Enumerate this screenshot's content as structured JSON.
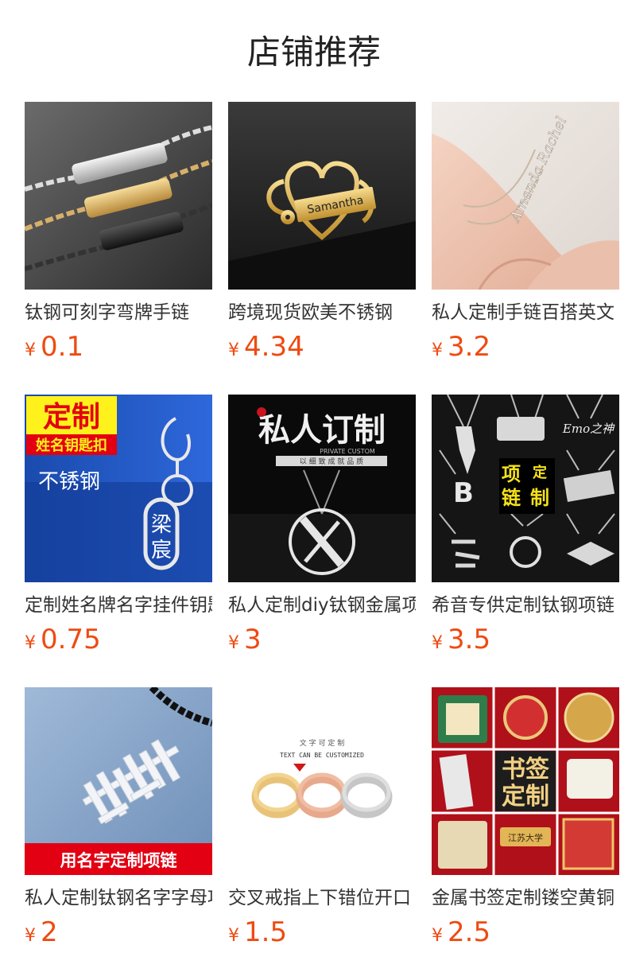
{
  "section_title": "店铺推荐",
  "colors": {
    "price": "#ee4b12",
    "title": "#222222",
    "name": "#333333"
  },
  "products": [
    {
      "name": "钛钢可刻字弯牌手链",
      "currency": "¥",
      "price": "0.1",
      "image": "engraved-bar-chain-bracelets-image"
    },
    {
      "name": "跨境现货欧美不锈钢",
      "currency": "¥",
      "price": "4.34",
      "image": "stethoscope-heart-name-badge-image",
      "image_text": "Samantha"
    },
    {
      "name": "私人定制手链百搭英文",
      "currency": "¥",
      "price": "3.2",
      "image": "name-bracelet-on-wrist-image",
      "image_text": "Amanda Rachel"
    },
    {
      "name": "定制姓名牌名字挂件钥匙扣",
      "currency": "¥",
      "price": "0.75",
      "image": "name-keychain-image",
      "image_text": [
        "定制",
        "姓名钥匙扣",
        "不锈钢",
        "梁",
        "宸"
      ]
    },
    {
      "name": "私人定制diy钛钢金属项链",
      "currency": "¥",
      "price": "3",
      "image": "x-letter-pendant-image",
      "image_text": [
        "私人订制",
        "PRIVATE CUSTOM",
        "以 细 致 成 就 品 质"
      ]
    },
    {
      "name": "希音专供定制钛钢项链",
      "currency": "¥",
      "price": "3.5",
      "image": "custom-necklace-collage-image",
      "image_text": [
        "项",
        "定",
        "链",
        "制",
        "Emo之神",
        "B"
      ]
    },
    {
      "name": "私人定制钛钢名字字母项链",
      "currency": "¥",
      "price": "2",
      "image": "name-necklace-pendant-image",
      "image_text": "用名字定制项链"
    },
    {
      "name": "交叉戒指上下错位开口",
      "currency": "¥",
      "price": "1.5",
      "image": "crossed-open-rings-image",
      "image_text": [
        "文 字 可 定 制",
        "TEXT CAN BE CUSTOMIZED"
      ]
    },
    {
      "name": "金属书签定制镂空黄铜",
      "currency": "¥",
      "price": "2.5",
      "image": "metal-bookmarks-collage-image",
      "image_text": [
        "书签",
        "定制",
        "江苏大学"
      ]
    }
  ]
}
